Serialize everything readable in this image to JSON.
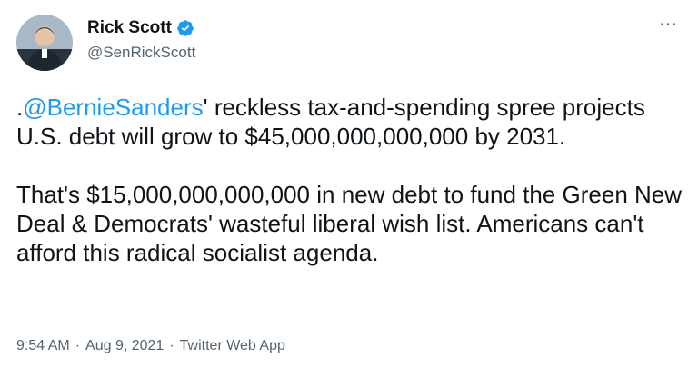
{
  "author": {
    "display_name": "Rick Scott",
    "handle": "@SenRickScott",
    "verified_icon": "verified-badge-icon"
  },
  "menu_icon": "more-options-icon",
  "tweet": {
    "prefix": ".",
    "mention": "@BernieSanders",
    "para1_rest": "' reckless tax-and-spending spree projects U.S. debt will grow to $45,000,000,000,000 by 2031.",
    "para2": "That's $15,000,000,000,000 in new debt to fund the Green New Deal & Democrats' wasteful liberal wish list. Americans can't afford this radical socialist agenda."
  },
  "meta": {
    "time": "9:54 AM",
    "date": "Aug 9, 2021",
    "source": "Twitter Web App",
    "separator": "·"
  },
  "colors": {
    "link": "#1d9bf0",
    "secondary_text": "#536471",
    "primary_text": "#0f1419"
  }
}
